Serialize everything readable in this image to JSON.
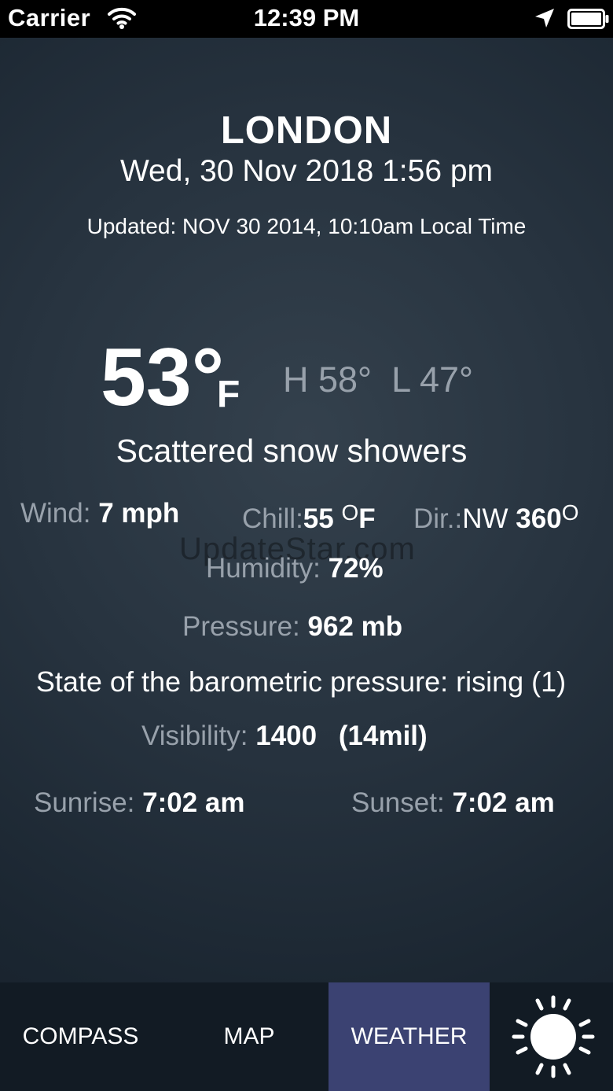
{
  "status_bar": {
    "carrier": "Carrier",
    "time": "12:39 PM",
    "icons": [
      "wifi-icon",
      "location-arrow-icon",
      "battery-icon"
    ]
  },
  "header": {
    "city": "LONDON",
    "datetime": "Wed, 30 Nov 2018 1:56 pm",
    "updated": "Updated: NOV 30 2014, 10:10am Local Time"
  },
  "current": {
    "temperature": "53°",
    "unit": "F",
    "high": "H 58°",
    "low": "L 47°",
    "condition": "Scattered snow showers"
  },
  "details": {
    "wind_label": "Wind:",
    "wind_value": "7 mph",
    "chill_label": "Chill:",
    "chill_value": "55",
    "chill_degree": "O",
    "chill_unit": "F",
    "dir_label": "Dir.:",
    "dir_value": "NW",
    "dir_degrees": "360",
    "dir_degree_mark": "O",
    "humidity_label": "Humidity:",
    "humidity_value": "72%",
    "pressure_label": "Pressure:",
    "pressure_value": "962 mb",
    "barometric": "State of the barometric pressure: rising (1)",
    "visibility_label": "Visibility:",
    "visibility_value": "1400",
    "visibility_extra": "(14mil)",
    "sunrise_label": "Sunrise:",
    "sunrise_value": "7:02 am",
    "sunset_label": "Sunset:",
    "sunset_value": "7:02 am"
  },
  "watermark": "UpdateStar.com",
  "tabs": [
    {
      "label": "COMPASS",
      "active": false
    },
    {
      "label": "MAP",
      "active": false
    },
    {
      "label": "WEATHER",
      "active": true
    }
  ],
  "weather_icon": "sun-icon",
  "colors": {
    "background": "#27333f",
    "tab_bar": "#121b24",
    "active_tab": "#3b4272",
    "label_gray": "#98a1ab"
  }
}
